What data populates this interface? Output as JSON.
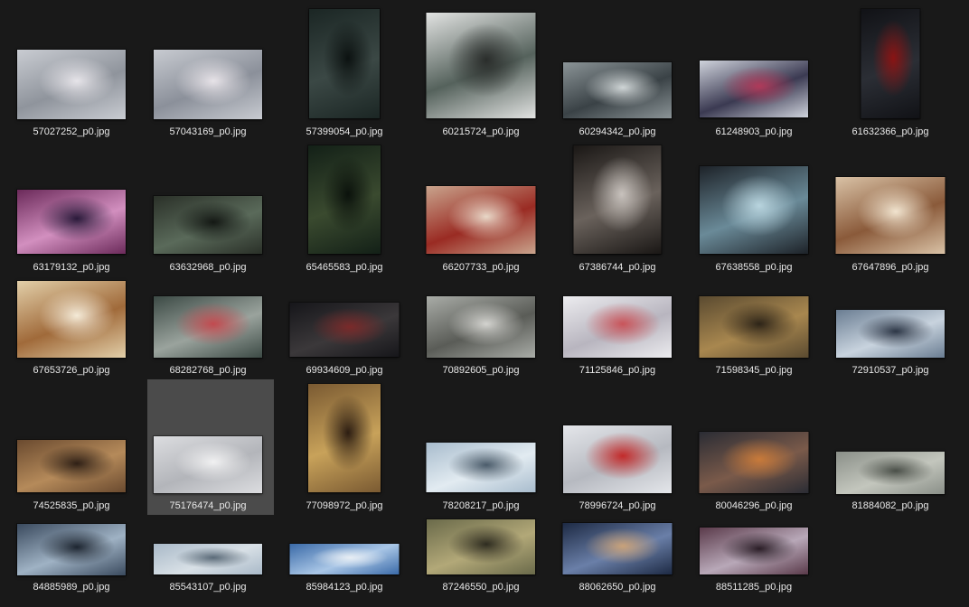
{
  "files": [
    {
      "name": "57027252_p0.jpg",
      "colors": [
        "#c9ccd2",
        "#8f949c",
        "#e6e4e9"
      ]
    },
    {
      "name": "57043169_p0.jpg",
      "colors": [
        "#c8cbd1",
        "#8b909a",
        "#e7e3e8"
      ]
    },
    {
      "name": "57399054_p0.jpg",
      "colors": [
        "#1b2624",
        "#3b4845",
        "#0c1211"
      ]
    },
    {
      "name": "60215724_p0.jpg",
      "colors": [
        "#e2e3e2",
        "#55625c",
        "#2a2d2b"
      ]
    },
    {
      "name": "60294342_p0.jpg",
      "colors": [
        "#8b9497",
        "#3a4246",
        "#cfd5d6"
      ]
    },
    {
      "name": "61248903_p0.jpg",
      "colors": [
        "#cfd3dc",
        "#3b3a52",
        "#b03a5a"
      ]
    },
    {
      "name": "61632366_p0.jpg",
      "colors": [
        "#111216",
        "#2b2e35",
        "#8a1414"
      ]
    },
    {
      "name": "63179132_p0.jpg",
      "colors": [
        "#6b2a5a",
        "#d28fbf",
        "#2a1a3a"
      ]
    },
    {
      "name": "63632968_p0.jpg",
      "colors": [
        "#2a3028",
        "#5a6a5a",
        "#141814"
      ]
    },
    {
      "name": "65465583_p0.jpg",
      "colors": [
        "#132017",
        "#3a4a2f",
        "#0b120c"
      ]
    },
    {
      "name": "66207733_p0.jpg",
      "colors": [
        "#c9a48d",
        "#9a2b23",
        "#e8d7c7"
      ]
    },
    {
      "name": "67386744_p0.jpg",
      "colors": [
        "#1a1715",
        "#6a625c",
        "#c8c2bd"
      ]
    },
    {
      "name": "67638558_p0.jpg",
      "colors": [
        "#1d2228",
        "#6a8a98",
        "#b8d4de"
      ]
    },
    {
      "name": "67647896_p0.jpg",
      "colors": [
        "#d9c2a6",
        "#8a5a3a",
        "#f1e4cf"
      ]
    },
    {
      "name": "67653726_p0.jpg",
      "colors": [
        "#e2cfa9",
        "#a06a3a",
        "#f4ead7"
      ]
    },
    {
      "name": "68282768_p0.jpg",
      "colors": [
        "#3c4a45",
        "#9aa39d",
        "#c24a4f"
      ]
    },
    {
      "name": "69934609_p0.jpg",
      "colors": [
        "#16161a",
        "#3b383a",
        "#7a2a2a"
      ]
    },
    {
      "name": "70892605_p0.jpg",
      "colors": [
        "#a9aca7",
        "#5a5c57",
        "#d3d3cf"
      ]
    },
    {
      "name": "71125846_p0.jpg",
      "colors": [
        "#ececef",
        "#b8b5bf",
        "#c9545a"
      ]
    },
    {
      "name": "71598345_p0.jpg",
      "colors": [
        "#5a4a30",
        "#a8874f",
        "#2d2418"
      ]
    },
    {
      "name": "72910537_p0.jpg",
      "colors": [
        "#6a7d92",
        "#c8d3de",
        "#2c3646"
      ]
    },
    {
      "name": "74525835_p0.jpg",
      "colors": [
        "#6a4a2f",
        "#b58a5a",
        "#2f2016"
      ]
    },
    {
      "name": "75176474_p0.jpg",
      "colors": [
        "#dcdde0",
        "#b3b5ba",
        "#f1f1f2"
      ]
    },
    {
      "name": "77098972_p0.jpg",
      "colors": [
        "#7a5a32",
        "#c8a25a",
        "#2c1d12"
      ]
    },
    {
      "name": "78208217_p0.jpg",
      "colors": [
        "#a8bccd",
        "#e2ebf1",
        "#4a5b6a"
      ]
    },
    {
      "name": "78996724_p0.jpg",
      "colors": [
        "#e4e6ea",
        "#b6b9c0",
        "#c22a2a"
      ]
    },
    {
      "name": "80046296_p0.jpg",
      "colors": [
        "#2a2c34",
        "#7a5a4a",
        "#c87a3a"
      ]
    },
    {
      "name": "81884082_p0.jpg",
      "colors": [
        "#8a8f88",
        "#c3c6bd",
        "#4a4f48"
      ]
    },
    {
      "name": "84885989_p0.jpg",
      "colors": [
        "#3a4a5e",
        "#9fb2c4",
        "#1d2530"
      ]
    },
    {
      "name": "85543107_p0.jpg",
      "colors": [
        "#a9b9c8",
        "#d8e0e6",
        "#5a6a78"
      ]
    },
    {
      "name": "85984123_p0.jpg",
      "colors": [
        "#3a6aa8",
        "#a9c6e6",
        "#e8eef4"
      ]
    },
    {
      "name": "87246550_p0.jpg",
      "colors": [
        "#6a6a4a",
        "#b2a878",
        "#2e2c20"
      ]
    },
    {
      "name": "88062650_p0.jpg",
      "colors": [
        "#1d2a44",
        "#6a7fa8",
        "#c9a27a"
      ]
    },
    {
      "name": "88511285_p0.jpg",
      "colors": [
        "#5a3a4a",
        "#b8a8b8",
        "#2a1d26"
      ]
    }
  ],
  "selected_name": "75176474_p0.jpg"
}
